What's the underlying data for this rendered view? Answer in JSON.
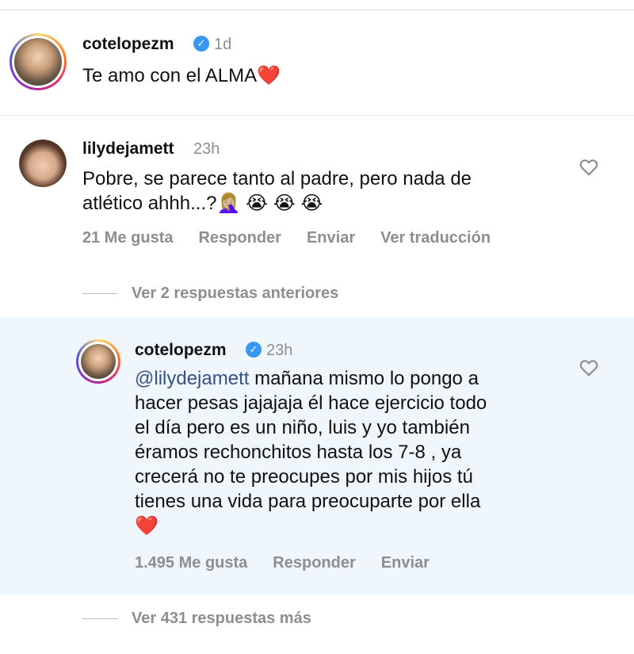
{
  "caption": {
    "username": "cotelopezm",
    "time": "1d",
    "text": "Te amo con el ALMA",
    "emoji": "❤️"
  },
  "comment": {
    "username": "lilydejamett",
    "time": "23h",
    "text_line1": "Pobre, se parece tanto al padre, pero nada de",
    "text_line2": "atlético ahhh...?🤦🏼‍♀️ 😭 😭 😭",
    "likes": "21 Me gusta",
    "reply": "Responder",
    "send": "Enviar",
    "translate": "Ver traducción"
  },
  "view_previous": "Ver 2 respuestas anteriores",
  "reply": {
    "username": "cotelopezm",
    "time": "23h",
    "mention": "@lilydejamett",
    "text_line1": " mañana mismo lo pongo a",
    "text_line2": "hacer pesas jajajaja él hace ejercicio todo",
    "text_line3": "el día pero es un niño, luis y yo también",
    "text_line4": "éramos rechonchitos hasta los 7-8 , ya",
    "text_line5": "crecerá no te preocupes por mis hijos tú",
    "text_line6": "tienes una vida para preocuparte por ella",
    "text_line7": "❤️",
    "likes": "1.495 Me gusta",
    "reply_btn": "Responder",
    "send": "Enviar"
  },
  "view_more": "Ver 431 respuestas más",
  "verified_mark": "✓",
  "icons": {
    "like": "heart-outline-icon",
    "verified": "verified-badge-icon"
  },
  "colors": {
    "verified": "#3897f0",
    "mention": "#385185",
    "reply_highlight": "#eff6fc",
    "muted": "#8e8e8e"
  }
}
